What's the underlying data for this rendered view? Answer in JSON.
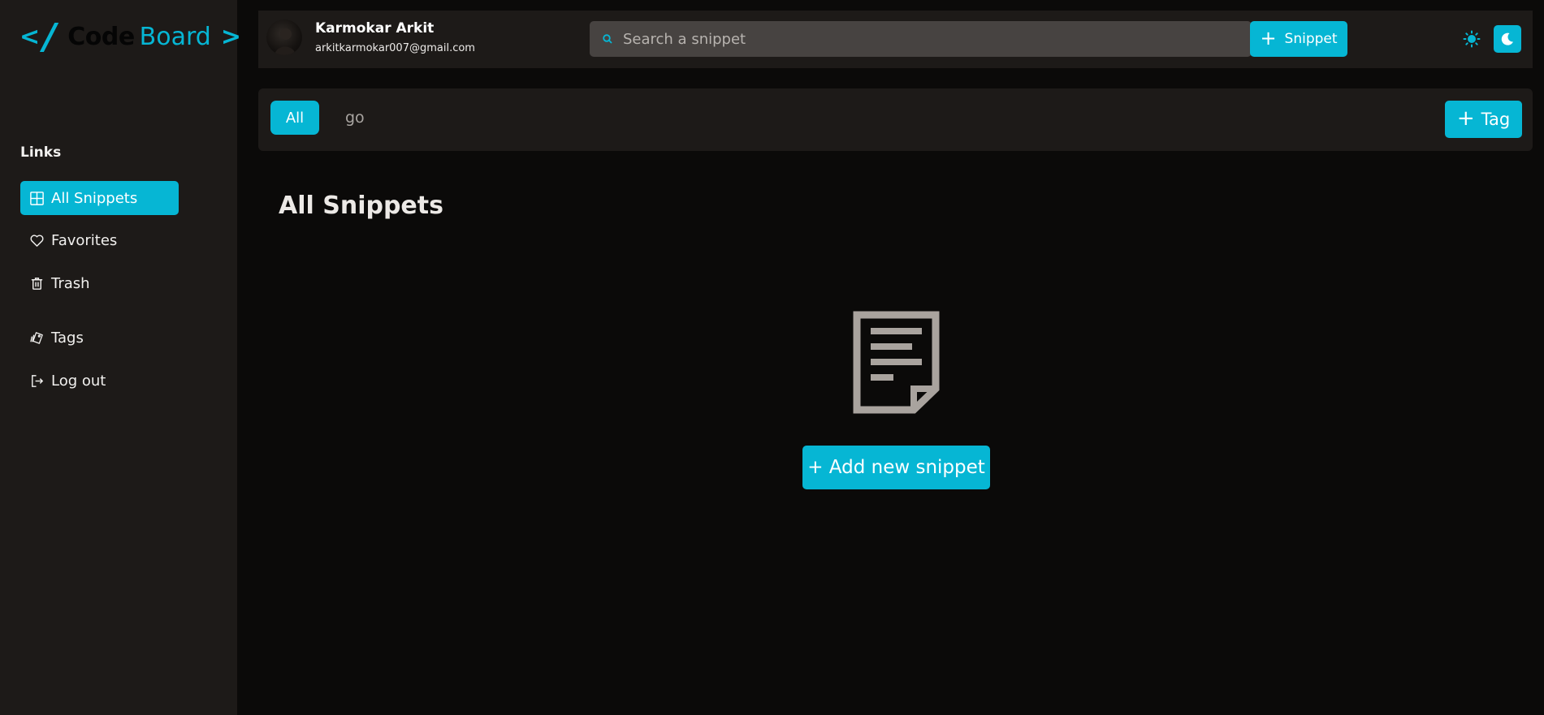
{
  "logo": {
    "open_bracket": "<",
    "slash": "/",
    "code": "Code",
    "board": "Board",
    "close_bracket": ">"
  },
  "sidebar": {
    "heading": "Links",
    "items": [
      {
        "label": "All Snippets",
        "icon": "grid-icon",
        "active": true
      },
      {
        "label": "Favorites",
        "icon": "heart-icon",
        "active": false
      },
      {
        "label": "Trash",
        "icon": "trash-icon",
        "active": false
      },
      {
        "label": "Tags",
        "icon": "tags-icon",
        "active": false
      },
      {
        "label": "Log out",
        "icon": "logout-icon",
        "active": false
      }
    ]
  },
  "header": {
    "user_name": "Karmokar Arkit",
    "user_email": "arkitkarmokar007@gmail.com",
    "search_placeholder": "Search a snippet",
    "snippet_button": "Snippet",
    "plus": "+"
  },
  "tags": {
    "items": [
      {
        "label": "All",
        "active": true
      },
      {
        "label": "go",
        "active": false
      }
    ],
    "add_button": "Tag",
    "plus": "+"
  },
  "main": {
    "title": "All Snippets",
    "add_button": "+ Add new snippet"
  },
  "colors": {
    "accent": "#06b6d4",
    "sidebar_bg": "#1d1a18",
    "page_bg": "#0b0a09",
    "search_bg": "#474341"
  }
}
